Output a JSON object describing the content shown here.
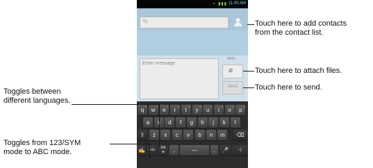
{
  "status_bar": {
    "time": "11:00 AM",
    "icons": "⚬ ▮▮▮"
  },
  "recipient": {
    "placeholder": "To"
  },
  "message": {
    "placeholder": "Enter message"
  },
  "mms_indicator": "MMS",
  "send_button": {
    "label": "Send"
  },
  "keyboard": {
    "row1": [
      {
        "key": "q",
        "sub": "1"
      },
      {
        "key": "w",
        "sub": "2"
      },
      {
        "key": "e",
        "sub": "3"
      },
      {
        "key": "r",
        "sub": "4"
      },
      {
        "key": "t",
        "sub": "5"
      },
      {
        "key": "y",
        "sub": "6"
      },
      {
        "key": "u",
        "sub": "7"
      },
      {
        "key": "i",
        "sub": "8"
      },
      {
        "key": "o",
        "sub": "9"
      },
      {
        "key": "p",
        "sub": "0"
      }
    ],
    "row2": [
      "a",
      "s",
      "d",
      "f",
      "g",
      "h",
      "j",
      "k",
      "l"
    ],
    "row3": [
      "z",
      "x",
      "c",
      "v",
      "b",
      "n",
      "m"
    ],
    "language_key": {
      "top": "EN",
      "bottom": "⊕"
    },
    "sym_key_label": "a1s",
    "comma": ",",
    "period": ".",
    "smiley": ":-)"
  },
  "callouts": {
    "add_contacts": [
      "Touch here to add contacts",
      "from the contact list."
    ],
    "attach_files": "Touch here to attach files.",
    "send": "Touch here to send.",
    "languages": [
      "Toggles between",
      "different languages."
    ],
    "mode": [
      "Toggles from 123/SYM",
      "mode to ABC mode."
    ]
  }
}
